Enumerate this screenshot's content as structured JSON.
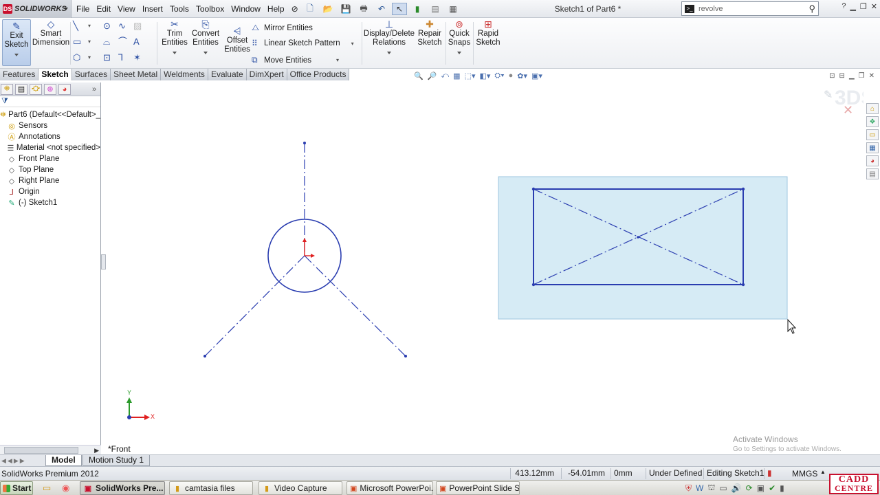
{
  "app": {
    "brand": "SOLIDWORKS",
    "document_title": "Sketch1 of Part6 *"
  },
  "menu": [
    "File",
    "Edit",
    "View",
    "Insert",
    "Tools",
    "Toolbox",
    "Window",
    "Help"
  ],
  "search": {
    "value": "revolve"
  },
  "command_manager": {
    "exit_sketch": "Exit\nSketch",
    "exit_sketch_l1": "Exit",
    "exit_sketch_l2": "Sketch",
    "smart_dimension_l1": "Smart",
    "smart_dimension_l2": "Dimension",
    "trim_l1": "Trim",
    "trim_l2": "Entities",
    "convert_l1": "Convert",
    "convert_l2": "Entities",
    "offset_l1": "Offset",
    "offset_l2": "Entities",
    "mirror": "Mirror Entities",
    "linear_pattern": "Linear Sketch Pattern",
    "move": "Move Entities",
    "display_delete_l1": "Display/Delete",
    "display_delete_l2": "Relations",
    "repair_l1": "Repair",
    "repair_l2": "Sketch",
    "quick_snaps_l1": "Quick",
    "quick_snaps_l2": "Snaps",
    "rapid_sketch_l1": "Rapid",
    "rapid_sketch_l2": "Sketch"
  },
  "tabs": [
    "Features",
    "Sketch",
    "Surfaces",
    "Sheet Metal",
    "Weldments",
    "Evaluate",
    "DimXpert",
    "Office Products"
  ],
  "active_tab": "Sketch",
  "feature_tree": {
    "root": "Part6  (Default<<Default>_",
    "items": [
      {
        "label": "Sensors",
        "icon": "sensor-icon"
      },
      {
        "label": "Annotations",
        "icon": "annotations-icon"
      },
      {
        "label": "Material <not specified>",
        "icon": "material-icon"
      },
      {
        "label": "Front Plane",
        "icon": "plane-icon"
      },
      {
        "label": "Top Plane",
        "icon": "plane-icon"
      },
      {
        "label": "Right Plane",
        "icon": "plane-icon"
      },
      {
        "label": "Origin",
        "icon": "origin-icon"
      },
      {
        "label": "(-) Sketch1",
        "icon": "sketch-icon"
      }
    ]
  },
  "graphics": {
    "view_label": "*Front",
    "triad_x": "X",
    "triad_y": "Y",
    "watermark_title": "Activate Windows",
    "watermark_sub": "Go to Settings to activate Windows."
  },
  "bottom_tabs": {
    "model": "Model",
    "motion": "Motion Study 1"
  },
  "status": {
    "product": "SolidWorks Premium 2012",
    "x": "413.12mm",
    "y": "-54.01mm",
    "z": "0mm",
    "sketch_state": "Under Defined",
    "editing": "Editing Sketch1",
    "units": "MMGS"
  },
  "taskbar": {
    "start": "Start",
    "items": [
      "SolidWorks Pre...",
      "camtasia files",
      "Video Capture",
      "Microsoft PowerPoi...",
      "PowerPoint Slide S..."
    ]
  },
  "watermark_logo": {
    "line1": "CADD",
    "line2": "CENTRE"
  },
  "colors": {
    "sketch_line": "#2a3db0",
    "selection_box": "#d6ebf5",
    "origin_red": "#e02020"
  }
}
